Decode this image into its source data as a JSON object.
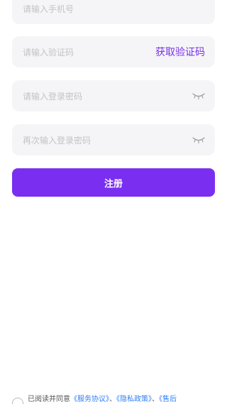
{
  "form": {
    "phone_placeholder": "请输入手机号",
    "code_placeholder": "请输入验证码",
    "get_code_label": "获取验证码",
    "password_placeholder": "请输入登录密码",
    "confirm_password_placeholder": "再次输入登录密码",
    "submit_label": "注册"
  },
  "agreement": {
    "prefix": "已阅读并同意",
    "service_link": "《服务协议》",
    "separator1": "、",
    "privacy_link": "《隐私政策》",
    "separator2": "、",
    "after_sales_link": "《售后"
  },
  "colors": {
    "accent": "#7a2ff0",
    "link": "#2f7ff6",
    "field_bg": "#f5f5f7",
    "placeholder": "#c3c3c8"
  },
  "icons": {
    "password_toggle": "eye-closed-icon"
  }
}
